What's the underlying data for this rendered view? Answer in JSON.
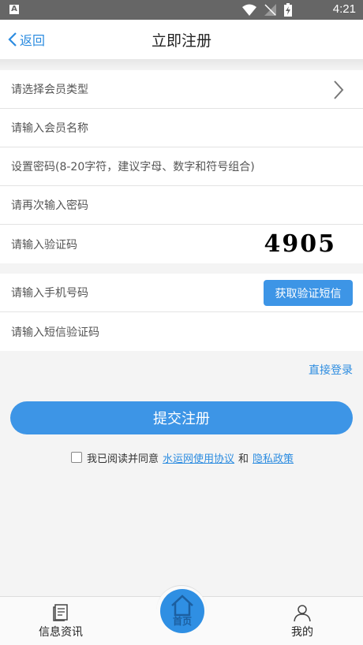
{
  "statusbar": {
    "time": "4:21",
    "app_icon_letter": "A"
  },
  "navbar": {
    "back_label": "返回",
    "title": "立即注册"
  },
  "form": {
    "member_type_placeholder": "请选择会员类型",
    "member_name_placeholder": "请输入会员名称",
    "password_placeholder": "设置密码(8-20字符，建议字母、数字和符号组合)",
    "confirm_password_placeholder": "请再次输入密码",
    "captcha_placeholder": "请输入验证码",
    "captcha_code": "4905",
    "phone_placeholder": "请输入手机号码",
    "sms_button_label": "获取验证短信",
    "sms_code_placeholder": "请输入短信验证码"
  },
  "login_link": "直接登录",
  "submit_label": "提交注册",
  "agreement": {
    "prefix": "我已阅读并同意",
    "terms_link": "水运网使用协议",
    "and": "和",
    "privacy_link": "隐私政策"
  },
  "tabbar": {
    "info_label": "信息资讯",
    "home_label": "首页",
    "me_label": "我的"
  },
  "colors": {
    "accent": "#3d95e6",
    "link": "#2c8ce0",
    "statusbar": "#666666"
  }
}
